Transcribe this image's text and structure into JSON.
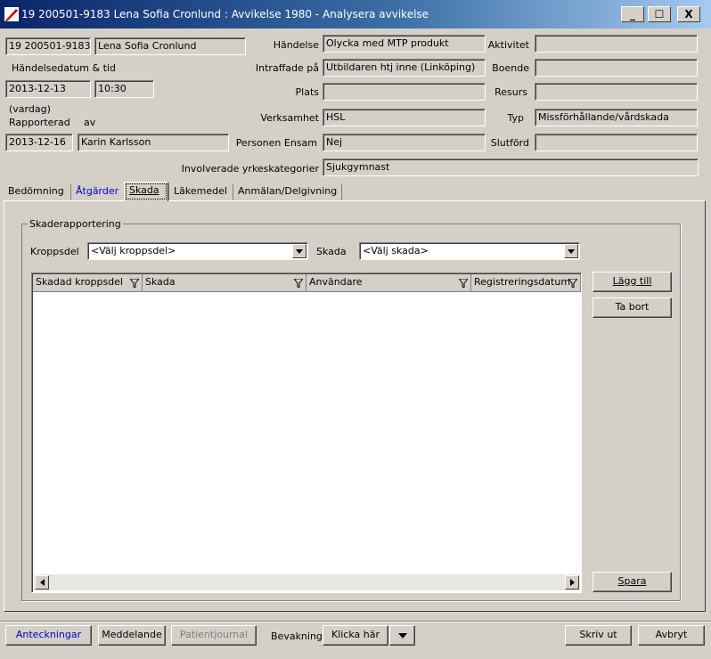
{
  "window": {
    "title": "19 200501-9183 Lena Sofia Cronlund : Avvikelse 1980   - Analysera avvikelse",
    "min_label": "_",
    "max_label": "☐",
    "close_label": "X"
  },
  "patient": {
    "id": "19 200501-9183",
    "name": "Lena Sofia Cronlund",
    "date_time_label": "Händelsedatum  & tid",
    "date": "2013-12-13",
    "time": "10:30",
    "day_type": "(vardag)",
    "reported_label": "Rapporterad",
    "by_label": "av",
    "reported_date": "2013-12-16",
    "reported_by": "Karin Karlsson"
  },
  "event": {
    "handelse_label": "Händelse",
    "handelse_value": "Olycka med MTP produkt",
    "intraffade_label": "Intraffade på",
    "intraffade_value": "Utbildaren htj inne (Linköping)",
    "plats_label": "Plats",
    "plats_value": "",
    "verksamhet_label": "Verksamhet",
    "verksamhet_value": "HSL",
    "ensam_label": "Personen Ensam",
    "ensam_value": "Nej",
    "yrke_label": "Involverade yrkeskategorier",
    "yrke_value": "Sjukgymnast",
    "aktivitet_label": "Aktivitet",
    "aktivitet_value": "",
    "boende_label": "Boende",
    "boende_value": "",
    "resurs_label": "Resurs",
    "resurs_value": "",
    "typ_label": "Typ",
    "typ_value": "Missförhållande/vårdskada",
    "slutford_label": "Slutförd",
    "slutford_value": ""
  },
  "tabs": [
    "Bedömning",
    "Åtgärder",
    "Skada",
    "Läkemedel",
    "Anmälan/Delgivning"
  ],
  "skada": {
    "group_label": "Skaderapportering",
    "kroppsdel_label": "Kroppsdel",
    "kroppsdel_value": "<Välj kroppsdel>",
    "skada_label": "Skada",
    "skada_value": "<Välj skada>",
    "columns": [
      "Skadad kroppsdel",
      "Skada",
      "Användare",
      "Registreringsdatum"
    ],
    "rows": [],
    "add_button": "Lägg till",
    "remove_button": "Ta bort",
    "save_button": "Spara"
  },
  "footer": {
    "anteckningar": "Anteckningar",
    "meddelande": "Meddelande",
    "patientjournal": "Patientjournal",
    "bevakning_label": "Bevakning",
    "klicka_har": "Klicka här",
    "skriv_ut": "Skriv ut",
    "avbryt": "Avbryt"
  },
  "colors": {
    "link_blue": "#0000cc",
    "disabled_text": "#808080",
    "titlebar": "#0a246a"
  }
}
